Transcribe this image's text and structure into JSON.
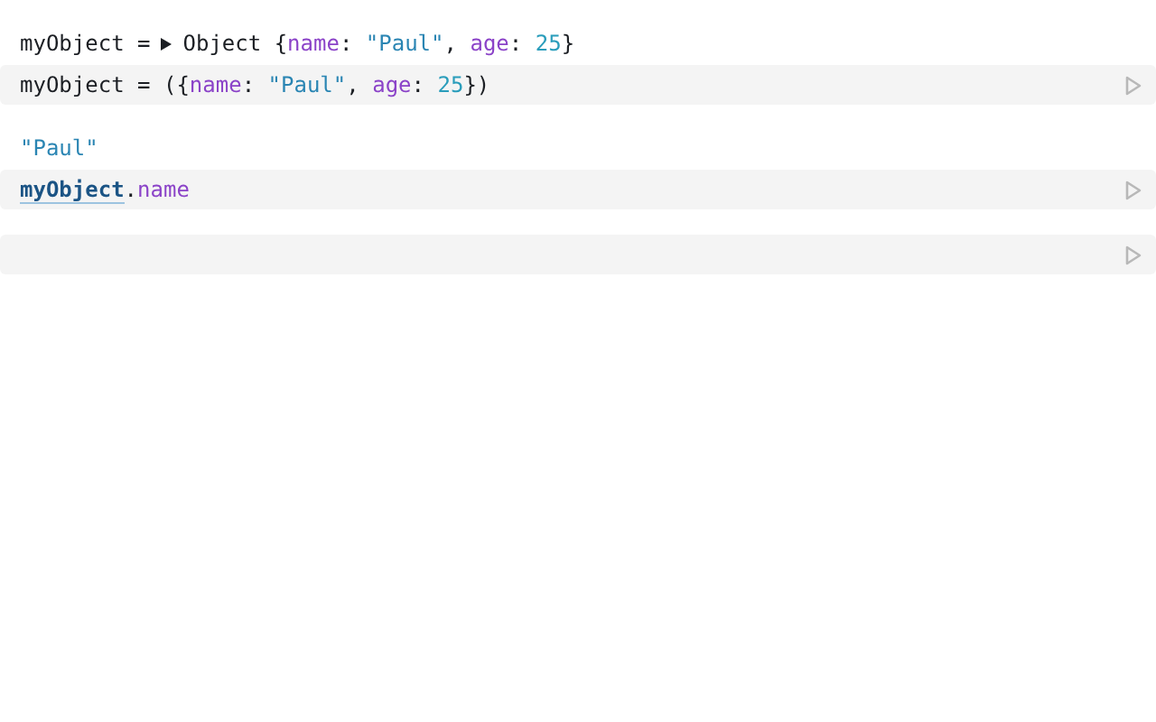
{
  "cells": [
    {
      "output": [
        {
          "kind": "text",
          "tokens": [
            {
              "kind": "plain",
              "text": "myObject ="
            }
          ]
        },
        {
          "kind": "toggle",
          "expanded": false
        },
        {
          "kind": "text",
          "tokens": [
            {
              "kind": "plain",
              "text": "Object {"
            },
            {
              "kind": "key",
              "text": "name"
            },
            {
              "kind": "plain",
              "text": ": "
            },
            {
              "kind": "string",
              "text": "\"Paul\""
            },
            {
              "kind": "plain",
              "text": ", "
            },
            {
              "kind": "key",
              "text": "age"
            },
            {
              "kind": "plain",
              "text": ": "
            },
            {
              "kind": "number",
              "text": "25"
            },
            {
              "kind": "plain",
              "text": "}"
            }
          ]
        }
      ],
      "code": [
        {
          "kind": "plain",
          "text": "myObject = ({"
        },
        {
          "kind": "key",
          "text": "name"
        },
        {
          "kind": "plain",
          "text": ": "
        },
        {
          "kind": "string",
          "text": "\"Paul\""
        },
        {
          "kind": "plain",
          "text": ", "
        },
        {
          "kind": "key",
          "text": "age"
        },
        {
          "kind": "plain",
          "text": ": "
        },
        {
          "kind": "number",
          "text": "25"
        },
        {
          "kind": "plain",
          "text": "})"
        }
      ]
    },
    {
      "output": [
        {
          "kind": "text",
          "tokens": [
            {
              "kind": "string",
              "text": "\"Paul\""
            }
          ]
        }
      ],
      "code": [
        {
          "kind": "ref",
          "text": "myObject"
        },
        {
          "kind": "plain",
          "text": "."
        },
        {
          "kind": "key",
          "text": "name"
        }
      ]
    },
    {}
  ]
}
